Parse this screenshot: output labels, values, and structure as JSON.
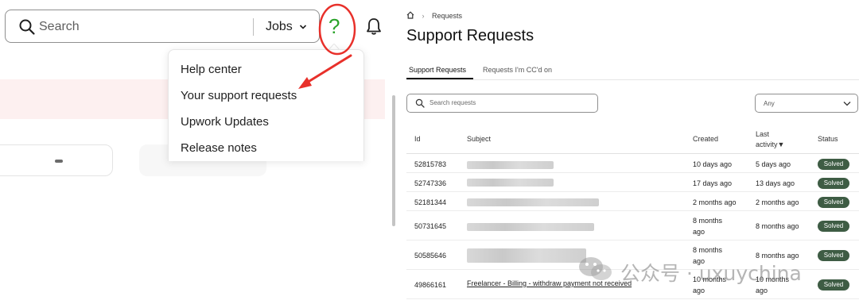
{
  "topbar": {
    "search_placeholder": "Search",
    "scope_label": "Jobs",
    "help_glyph": "?"
  },
  "help_menu": {
    "items": [
      {
        "label": "Help center"
      },
      {
        "label": "Your support requests"
      },
      {
        "label": "Upwork Updates"
      },
      {
        "label": "Release notes"
      }
    ]
  },
  "support": {
    "breadcrumb": {
      "current": "Requests"
    },
    "title": "Support Requests",
    "tabs": [
      {
        "label": "Support Requests",
        "active": true
      },
      {
        "label": "Requests I'm CC'd on",
        "active": false
      }
    ],
    "search_placeholder": "Search requests",
    "filter_value": "Any",
    "columns": {
      "id": "Id",
      "subject": "Subject",
      "created": "Created",
      "last_activity_1": "Last",
      "last_activity_2": "activity▼",
      "status": "Status"
    },
    "rows": [
      {
        "id": "52815783",
        "created": "10 days ago",
        "last_activity": "5 days ago",
        "status": "Solved"
      },
      {
        "id": "52747336",
        "created": "17 days ago",
        "last_activity": "13 days ago",
        "status": "Solved"
      },
      {
        "id": "52181344",
        "created": "2 months ago",
        "last_activity": "2 months ago",
        "status": "Solved"
      },
      {
        "id": "50731645",
        "created_1": "8 months",
        "created_2": "ago",
        "last_activity": "8 months ago",
        "status": "Solved"
      },
      {
        "id": "50585646",
        "created_1": "8 months",
        "created_2": "ago",
        "last_activity": "8 months ago",
        "status": "Solved"
      },
      {
        "id": "49866161",
        "subject": "Freelancer - Billing - withdraw payment not received",
        "created_1": "10 months",
        "created_2": "ago",
        "last_activity_1": "10 months",
        "last_activity_2": "ago",
        "status": "Solved"
      }
    ]
  },
  "watermark": {
    "text": "公众号 · uxuychina"
  },
  "colors": {
    "annotation_red": "#e8302a",
    "help_green": "#2aa32a",
    "badge_green": "#3e5c44",
    "alert_pink": "#fdf0f0"
  },
  "icons": [
    "search-icon",
    "chevron-down-icon",
    "help-icon",
    "bell-icon",
    "home-icon",
    "wechat-icon"
  ]
}
